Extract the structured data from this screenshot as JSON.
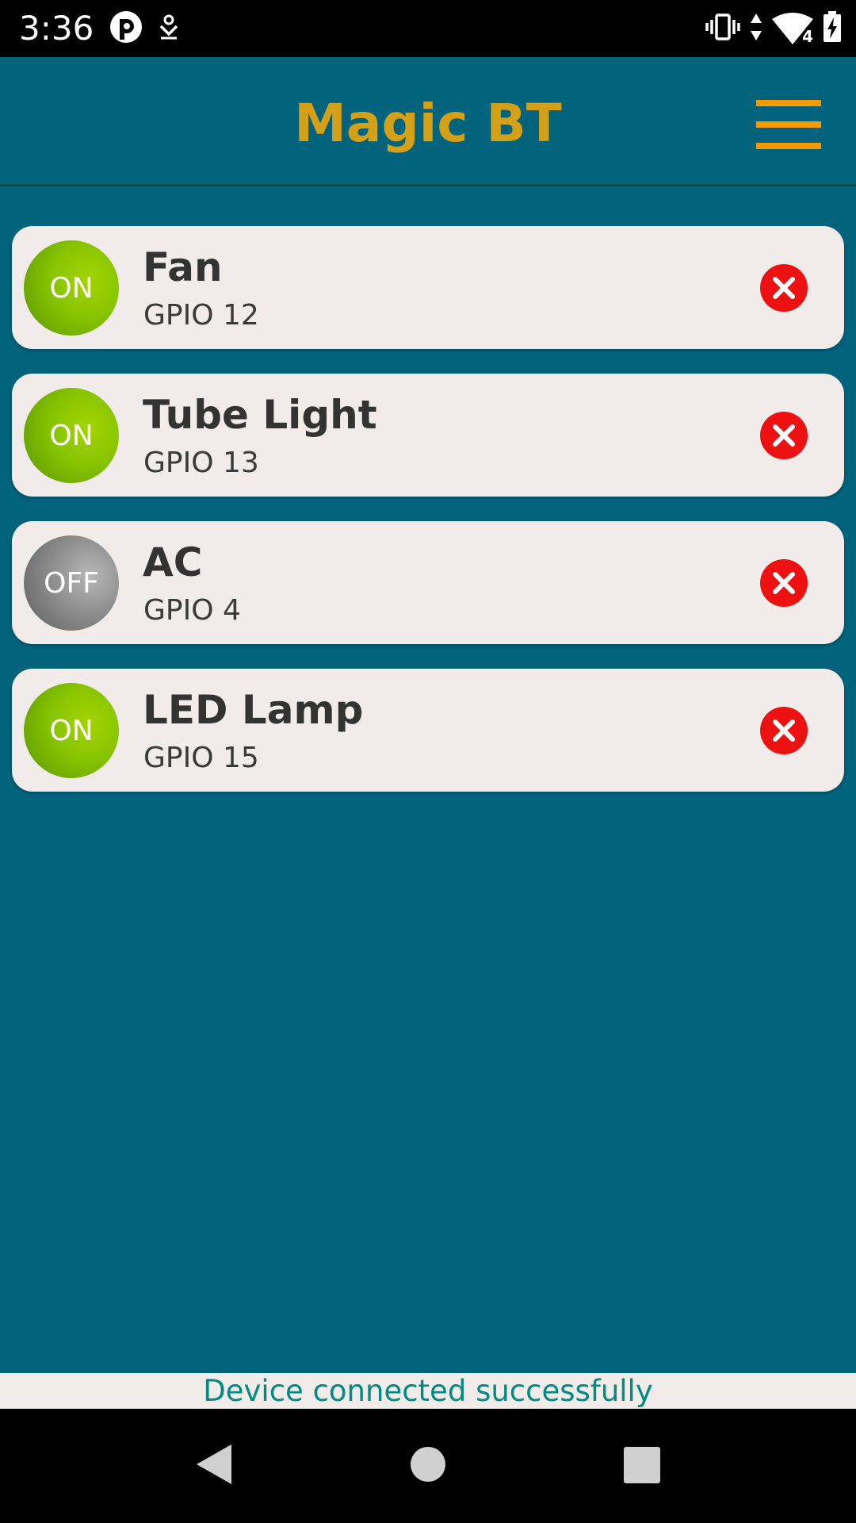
{
  "status_bar": {
    "time": "3:36",
    "signal_badge": "4",
    "icons": [
      "app-notification-icon",
      "download-icon",
      "vibrate-icon",
      "data-arrows-icon",
      "wifi-signal-icon",
      "battery-charging-icon"
    ]
  },
  "app_bar": {
    "title": "Magic BT",
    "menu_icon": "hamburger-menu-icon",
    "title_color": "#d4a017",
    "menu_color": "#f59a00"
  },
  "devices": [
    {
      "name": "Fan",
      "gpio": "GPIO 12",
      "state": "ON"
    },
    {
      "name": "Tube Light",
      "gpio": "GPIO 13",
      "state": "ON"
    },
    {
      "name": "AC",
      "gpio": "GPIO 4",
      "state": "OFF"
    },
    {
      "name": "LED Lamp",
      "gpio": "GPIO 15",
      "state": "ON"
    }
  ],
  "status_message": "Device connected successfully",
  "colors": {
    "background": "#02637d",
    "card": "#f1ece9",
    "on": "#86c300",
    "off": "#8d8d8d",
    "delete": "#ee1111",
    "status_text": "#008a80"
  },
  "nav_bar": {
    "buttons": [
      "back-icon",
      "home-icon",
      "recents-icon"
    ]
  }
}
